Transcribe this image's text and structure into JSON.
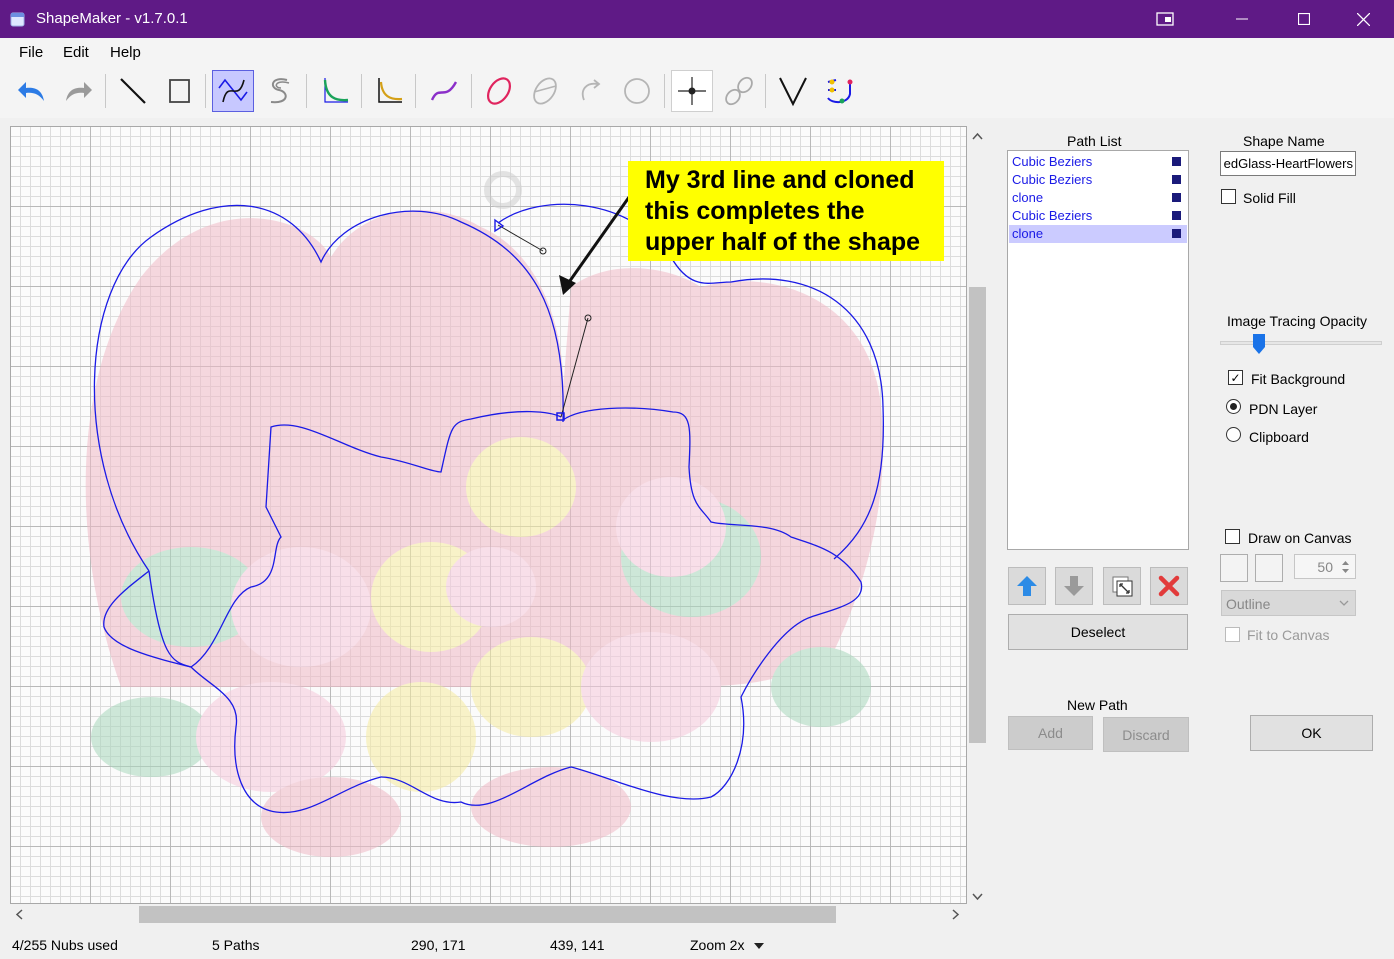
{
  "window": {
    "title": "ShapeMaker - v1.7.0.1",
    "controls": {
      "pin": "⧉",
      "minimize": "—",
      "maximize": "☐",
      "close": "✕"
    }
  },
  "menu": {
    "items": [
      "File",
      "Edit",
      "Help"
    ]
  },
  "toolbar": {
    "tools": [
      {
        "icon": "undo-icon"
      },
      {
        "icon": "redo-icon"
      },
      {
        "icon": "line-tool-icon"
      },
      {
        "icon": "rectangle-tool-icon"
      },
      {
        "icon": "cubic-bezier-tool-icon",
        "active": true
      },
      {
        "icon": "spline-tool-icon"
      },
      {
        "icon": "quadratic-bezier-icon"
      },
      {
        "icon": "smooth-quadratic-icon"
      },
      {
        "icon": "smooth-cubic-icon"
      },
      {
        "icon": "ellipse-tool-icon"
      },
      {
        "icon": "ellipse-arc-icon"
      },
      {
        "icon": "arc-arrow-icon"
      },
      {
        "icon": "circle-icon"
      },
      {
        "icon": "snap-point-icon"
      },
      {
        "icon": "link-path-icon"
      },
      {
        "icon": "v-icon"
      },
      {
        "icon": "gradient-path-icon"
      }
    ]
  },
  "canvas": {
    "annotation": [
      "My 3rd line and cloned",
      "this completes the",
      "upper half of the shape"
    ],
    "hscroll_left": "<",
    "hscroll_right": ">",
    "vscroll_up": "^",
    "vscroll_down": "v"
  },
  "path_list": {
    "label": "Path List",
    "items": [
      {
        "label": "Cubic Beziers",
        "selected": false
      },
      {
        "label": "Cubic Beziers",
        "selected": false
      },
      {
        "label": "clone",
        "selected": false
      },
      {
        "label": "Cubic Beziers",
        "selected": false
      },
      {
        "label": "clone",
        "selected": true
      }
    ],
    "deselect": "Deselect"
  },
  "new_path": {
    "label": "New Path",
    "add": "Add",
    "discard": "Discard"
  },
  "shape": {
    "name_label": "Shape Name",
    "name_value": "edGlass-HeartFlowers",
    "solid_fill": "Solid Fill"
  },
  "tracing": {
    "label": "Image Tracing Opacity",
    "opacity_fraction": 0.24,
    "fit_background": "Fit Background",
    "pdn_layer": "PDN Layer",
    "clipboard": "Clipboard"
  },
  "draw_canvas": {
    "label": "Draw on Canvas",
    "size_value": "50",
    "mode": "Outline",
    "fit_to_canvas": "Fit to Canvas"
  },
  "ok": "OK",
  "status": {
    "nubs": "4/255 Nubs used",
    "paths": "5 Paths",
    "pos1": "290, 171",
    "pos2": "439, 141",
    "zoom": "Zoom 2x"
  },
  "colors": {
    "title_bar": "#5f1a86",
    "path_blue": "#1a1ae6",
    "annotation_bg": "#ffff00"
  }
}
